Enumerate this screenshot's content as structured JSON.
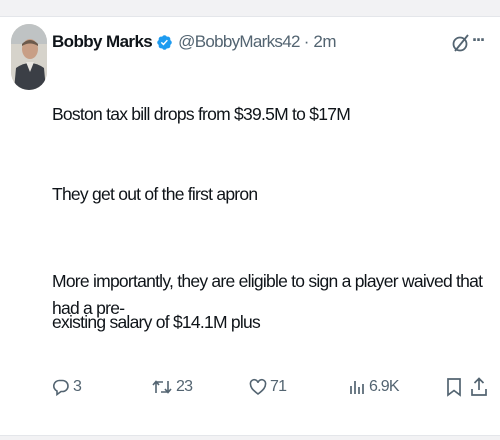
{
  "tweet": {
    "author_name": "Bobby Marks",
    "handle": "@BobbyMarks42",
    "separator": "·",
    "time": "2m",
    "lines": [
      "Boston tax bill drops from $39.5M to $17M",
      "They get out of the first apron",
      "More importantly, they are eligible to sign a player waived that had a pre-",
      "existing salary of $14.1M plus"
    ]
  },
  "actions": {
    "replies": "3",
    "reposts": "23",
    "likes": "71",
    "views": "6.9K"
  },
  "icons": {
    "verified": "verified-badge-icon",
    "grok": "grok-icon",
    "more": "more-icon",
    "reply": "reply-icon",
    "repost": "repost-icon",
    "like": "like-icon",
    "views": "views-icon",
    "bookmark": "bookmark-icon",
    "share": "share-icon"
  },
  "colors": {
    "verified": "#1d9bf0",
    "text": "#0f1419",
    "muted": "#536471"
  }
}
